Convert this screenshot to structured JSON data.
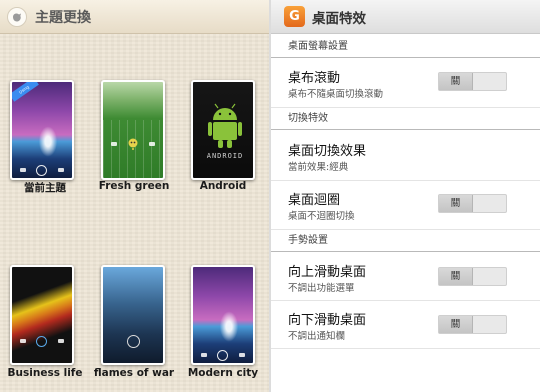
{
  "left_panel": {
    "title": "主題更換",
    "themes": [
      {
        "name": "當前主題",
        "current": true,
        "badge": "Using"
      },
      {
        "name": "Fresh green"
      },
      {
        "name": "Android",
        "logo_text": "ANDROID"
      },
      {
        "name": "Business life"
      },
      {
        "name": "flames of war"
      },
      {
        "name": "Modern city"
      }
    ]
  },
  "right_panel": {
    "app_icon_letter": "G",
    "title": "桌面特效",
    "sections": {
      "screen": "桌面螢幕設置",
      "switch": "切換特效",
      "gesture": "手勢設置"
    },
    "rows": {
      "scroll": {
        "title": "桌布滾動",
        "subtitle": "桌布不隨桌面切換滾動",
        "toggle": "關"
      },
      "effect": {
        "title": "桌面切換效果",
        "subtitle": "當前效果:經典"
      },
      "loop": {
        "title": "桌面迴圈",
        "subtitle": "桌面不迴圈切換",
        "toggle": "關"
      },
      "swipe_up": {
        "title": "向上滑動桌面",
        "subtitle": "不調出功能選單",
        "toggle": "關"
      },
      "swipe_down": {
        "title": "向下滑動桌面",
        "subtitle": "不調出通知欄",
        "toggle": "關"
      }
    },
    "colors": {
      "accent_orange": "#e3681b",
      "toggle_off": "#c4c4c4"
    }
  }
}
